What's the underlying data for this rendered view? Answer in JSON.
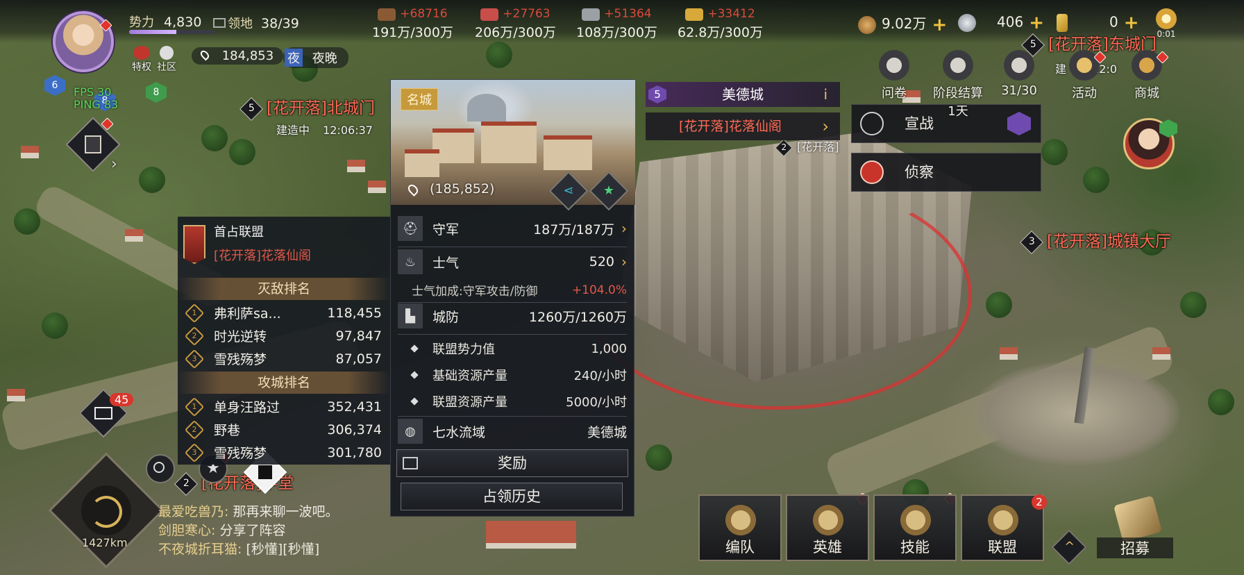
{
  "player": {
    "power_label": "势力",
    "power_value": "4,830",
    "power_progress": 0.55,
    "territory_label": "领地",
    "territory_value": "38/39",
    "coords": "184,853",
    "night_icon": "夜",
    "night_label": "夜晚",
    "privilege_label": "特权",
    "community_label": "社区",
    "fps_text": "FPS 30",
    "ping_text": "PING 83",
    "badge_left": "6",
    "badge_mid": "8",
    "badge_right": "8"
  },
  "resources": [
    {
      "name": "wood",
      "gain": "+68716",
      "amount": "191万/300万",
      "color": "#8a5a34"
    },
    {
      "name": "meat",
      "gain": "+27763",
      "amount": "206万/300万",
      "color": "#c94e4a"
    },
    {
      "name": "stone",
      "gain": "+51364",
      "amount": "108万/300万",
      "color": "#9aa0a4"
    },
    {
      "name": "gold",
      "gain": "+33412",
      "amount": "62.8万/300万",
      "color": "#d8a93a"
    }
  ],
  "currencies": {
    "copper": "9.02万",
    "silver": "406",
    "gem": "0",
    "sun_timer": "0:01"
  },
  "map_labels": {
    "north_gate_level": "5",
    "north_gate": "[花开落]北城门",
    "building_status": "建造中",
    "building_timer": "12:06:37",
    "east_gate_level": "5",
    "east_gate": "[花开落]东城门",
    "east_building_fragment": "建",
    "east_timer_fragment": "12:0",
    "town_hall_level": "3",
    "town_hall": "[花开落]城镇大厅",
    "school_level": "2",
    "school": "[花开落]学堂",
    "overlap_level": "2",
    "overlap_label": "[花开落]",
    "distance": "1427km",
    "mail_count": "45"
  },
  "ranking": {
    "first_alliance_label": "首占联盟",
    "first_alliance_name": "[花开落]花落仙阁",
    "kill_title": "灭敌排名",
    "kill": [
      {
        "rank": "1",
        "name": "弗利萨sa...",
        "value": "118,455"
      },
      {
        "rank": "2",
        "name": "时光逆转",
        "value": "97,847"
      },
      {
        "rank": "3",
        "name": "雪残殇梦",
        "value": "87,057"
      }
    ],
    "siege_title": "攻城排名",
    "siege": [
      {
        "rank": "1",
        "name": "单身汪路过",
        "value": "352,431"
      },
      {
        "rank": "2",
        "name": "野巷",
        "value": "306,374"
      },
      {
        "rank": "3",
        "name": "雪残殇梦",
        "value": "301,780"
      }
    ]
  },
  "city": {
    "tag": "名城",
    "coords": "(185,852)",
    "garrison_label": "守军",
    "garrison_value": "187万/187万",
    "morale_label": "士气",
    "morale_value": "520",
    "morale_bonus_label": "士气加成:守军攻击/防御",
    "morale_bonus_value": "+104.0%",
    "defense_label": "城防",
    "defense_value": "1260万/1260万",
    "alliance_power_label": "联盟势力值",
    "alliance_power_value": "1,000",
    "base_output_label": "基础资源产量",
    "base_output_value": "240/小时",
    "alliance_output_label": "联盟资源产量",
    "alliance_output_value": "5000/小时",
    "region_label": "七水流域",
    "region_value": "美德城",
    "reward_button": "奖励",
    "history_button": "占领历史"
  },
  "target_menu": {
    "level": "5",
    "city_name": "美德城",
    "info_icon": "i",
    "owner": "[花开落]花落仙阁",
    "declare_war": "宣战",
    "scout": "侦察"
  },
  "events": [
    {
      "name": "survey",
      "label": "问卷"
    },
    {
      "name": "stage-settlement",
      "label": "阶段结算",
      "sub": "1天"
    },
    {
      "name": "progress",
      "label": "31/30"
    },
    {
      "name": "activity",
      "label": "活动"
    },
    {
      "name": "shop",
      "label": "商城"
    }
  ],
  "chat": [
    {
      "who": "最爱吃兽乃:",
      "msg": "那再来聊一波吧。"
    },
    {
      "who": "剑胆寒心:",
      "msg": "分享了阵容"
    },
    {
      "who": "不夜城折耳猫:",
      "msg": "[秒懂][秒懂]"
    }
  ],
  "bottom_nav": [
    {
      "name": "formation",
      "label": "编队",
      "dot": true
    },
    {
      "name": "hero",
      "label": "英雄",
      "dot": true
    },
    {
      "name": "skill",
      "label": "技能",
      "dot": true
    },
    {
      "name": "alliance",
      "label": "联盟",
      "badge": "2"
    },
    {
      "name": "recruit",
      "label": "招募"
    }
  ]
}
